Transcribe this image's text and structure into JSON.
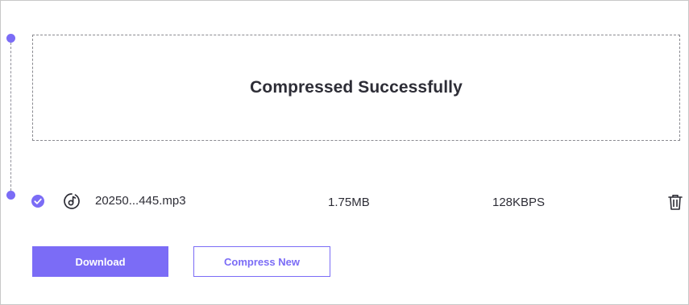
{
  "status": {
    "title": "Compressed Successfully"
  },
  "file": {
    "name": "20250...445.mp3",
    "size": "1.75MB",
    "bitrate": "128KBPS",
    "status_icon": "check-circle-icon",
    "type_icon": "music-disc-icon",
    "delete_icon": "trash-icon"
  },
  "actions": {
    "download_label": "Download",
    "compress_new_label": "Compress New"
  },
  "colors": {
    "accent": "#7b6cf6",
    "text": "#2d2d36",
    "border": "#c8c8c8"
  }
}
